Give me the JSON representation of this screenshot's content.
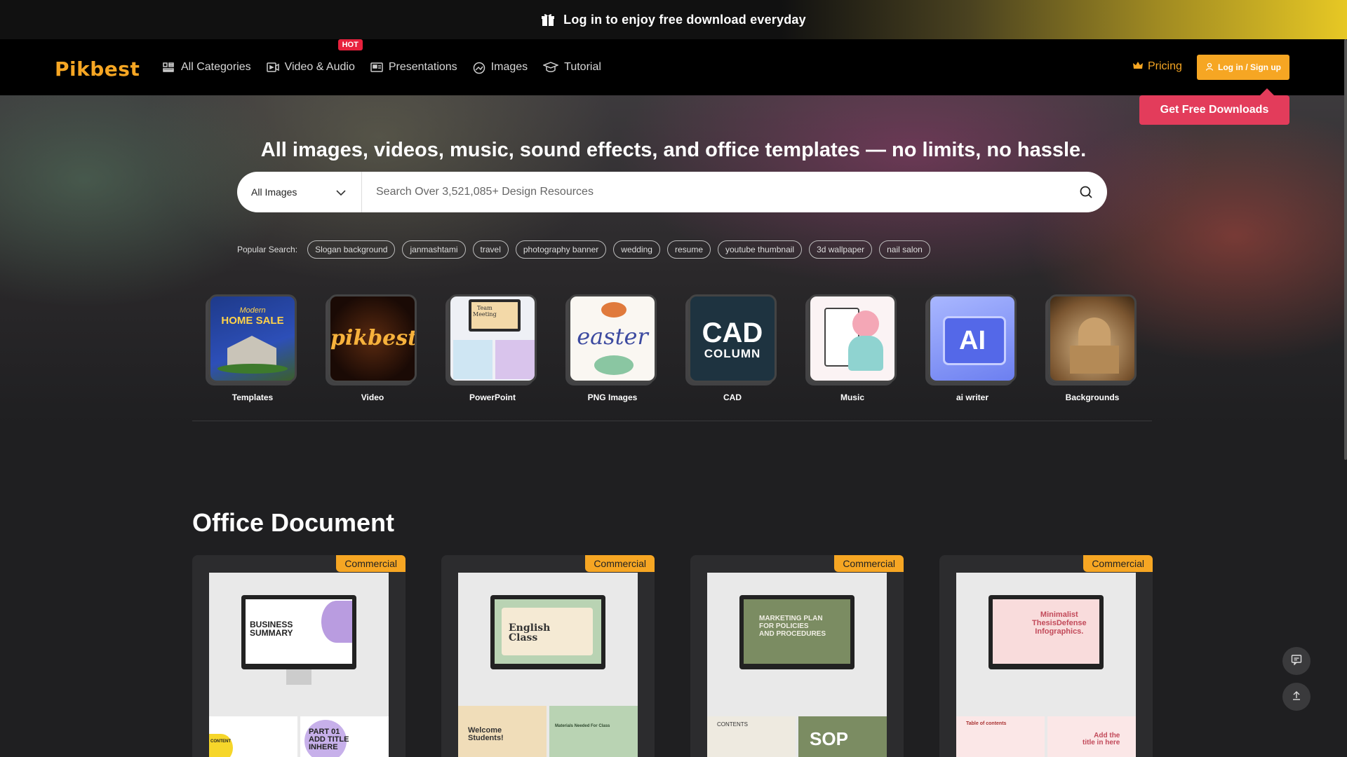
{
  "promo": {
    "text": "Log in to enjoy free download everyday"
  },
  "nav": {
    "logo": "Pikbest",
    "items": [
      {
        "label": "All Categories",
        "icon": "grid-icon"
      },
      {
        "label": "Video & Audio",
        "icon": "video-icon",
        "badge": "HOT"
      },
      {
        "label": "Presentations",
        "icon": "presentation-icon"
      },
      {
        "label": "Images",
        "icon": "image-icon"
      },
      {
        "label": "Tutorial",
        "icon": "graduation-cap-icon"
      }
    ],
    "pricing": "Pricing",
    "login": "Log in / Sign up",
    "free_downloads": "Get Free Downloads"
  },
  "hero": {
    "title": "All images, videos, music, sound effects, and office templates — no limits, no hassle.",
    "search": {
      "select_value": "All Images",
      "placeholder": "Search Over 3,521,085+ Design Resources"
    },
    "popular_label": "Popular Search:",
    "tags": [
      "Slogan background",
      "janmashtami",
      "travel",
      "photography banner",
      "wedding",
      "resume",
      "youtube thumbnail",
      "3d wallpaper",
      "nail salon"
    ]
  },
  "categories": [
    {
      "label": "Templates"
    },
    {
      "label": "Video"
    },
    {
      "label": "PowerPoint"
    },
    {
      "label": "PNG Images"
    },
    {
      "label": "CAD",
      "thumb_text": [
        "CAD",
        "COLUMN"
      ]
    },
    {
      "label": "Music"
    },
    {
      "label": "ai writer",
      "thumb_text": [
        "AI"
      ]
    },
    {
      "label": "Backgrounds"
    }
  ],
  "thumb_texts": {
    "templates": [
      "Modern",
      "HOME SALE"
    ],
    "video": "pikbest",
    "powerpoint": [
      "Team",
      "Meeting"
    ],
    "png": "easter"
  },
  "office": {
    "title": "Office Document",
    "cards": [
      {
        "badge": "Commercial",
        "screen_text": [
          "BUSINESS",
          "SUMMARY"
        ],
        "bottom_left": "CONTENT",
        "bottom_right": [
          "PART 01",
          "ADD TITLE",
          "INHERE"
        ]
      },
      {
        "badge": "Commercial",
        "screen_text": [
          "English",
          "Class"
        ],
        "bottom_left": [
          "Welcome",
          "Students!"
        ],
        "bottom_right": "Materials Needed For Class"
      },
      {
        "badge": "Commercial",
        "screen_text": [
          "MARKETING PLAN",
          "FOR POLICIES",
          "AND PROCEDURES"
        ],
        "bottom_left": "CONTENTS",
        "bottom_right": "SOP"
      },
      {
        "badge": "Commercial",
        "screen_text": [
          "Minimalist",
          "ThesisDefense",
          "Infographics."
        ],
        "bottom_left": "Table of contents",
        "bottom_right": [
          "Add the",
          "title in here"
        ]
      }
    ]
  },
  "colors": {
    "accent": "#f6a623",
    "cta": "#e33c5b"
  }
}
